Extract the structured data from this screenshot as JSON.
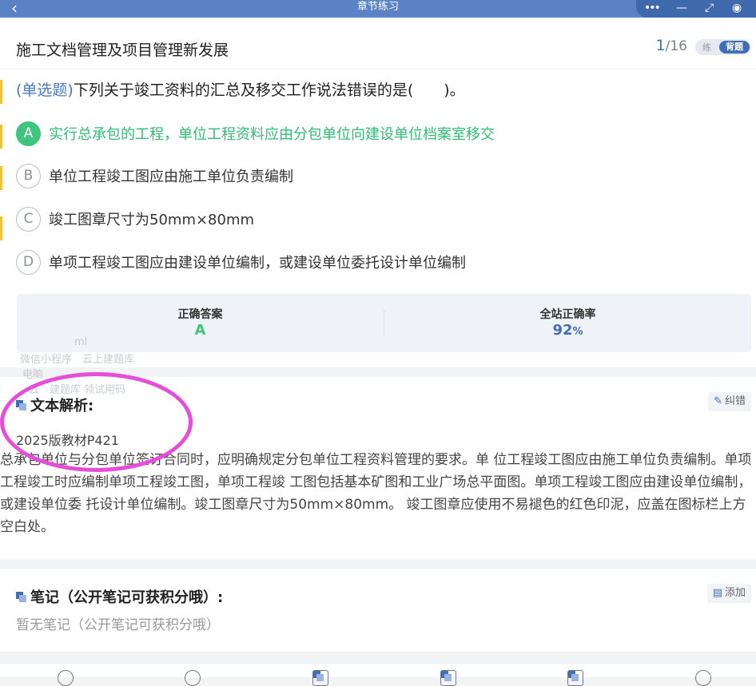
{
  "topbar": {
    "back_icon": "‹",
    "title": "章节练习",
    "more_icon": "•••",
    "minimize_icon": "—",
    "restore_icon": "⤢",
    "close_icon": "◉"
  },
  "header": {
    "chapter_title": "施工文档管理及项目管理新发展",
    "current": "1",
    "total": "/16",
    "mode_practice": "练",
    "mode_recite": "背题"
  },
  "question": {
    "type_label": "(单选题)",
    "text": "下列关于竣工资料的汇总及移交工作说法错误的是(　　)。"
  },
  "options": [
    {
      "letter": "A",
      "text": "实行总承包的工程，单位工程资料应由分包单位向建设单位档案室移交",
      "correct": true
    },
    {
      "letter": "B",
      "text": "单位工程竣工图应由施工单位负责编制",
      "correct": false
    },
    {
      "letter": "C",
      "text": "竣工图章尺寸为50mm×80mm",
      "correct": false
    },
    {
      "letter": "D",
      "text": "单项工程竣工图应由建设单位编制，或建设单位委托设计单位编制",
      "correct": false
    }
  ],
  "stats": {
    "answer_label": "正确答案",
    "answer_value": "A",
    "rate_label": "全站正确率",
    "rate_value": "92",
    "rate_unit": "%"
  },
  "watermark": {
    "line1": "ml",
    "line2": "微信小程序　云上建题库",
    "line3": "电脑",
    "line4": "云　建题库 领试用码"
  },
  "analysis": {
    "heading": "文本解析:",
    "fix_label": "纠错",
    "edition": "2025版教材P421",
    "text": "总承包单位与分包单位签订合同时，应明确规定分包单位工程资料管理的要求。单 位工程竣工图应由施工单位负责编制。单项工程竣工时应编制单项工程竣工图，单项工程竣 工图包括基本矿图和工业广场总平面图。单项工程竣工图应由建设单位编制，或建设单位委 托设计单位编制。竣工图章尺寸为50mm×80mm。 竣工图章应使用不易褪色的红色印泥，应盖在图标栏上方空白处。"
  },
  "notes": {
    "heading": "笔记（公开笔记可获积分哦）:",
    "add_label": "添加",
    "empty": "暂无笔记（公开笔记可获积分哦）"
  },
  "colors": {
    "brand": "#3f6fb5",
    "correct": "#3fc57e",
    "annotation": "#e64dd9"
  }
}
